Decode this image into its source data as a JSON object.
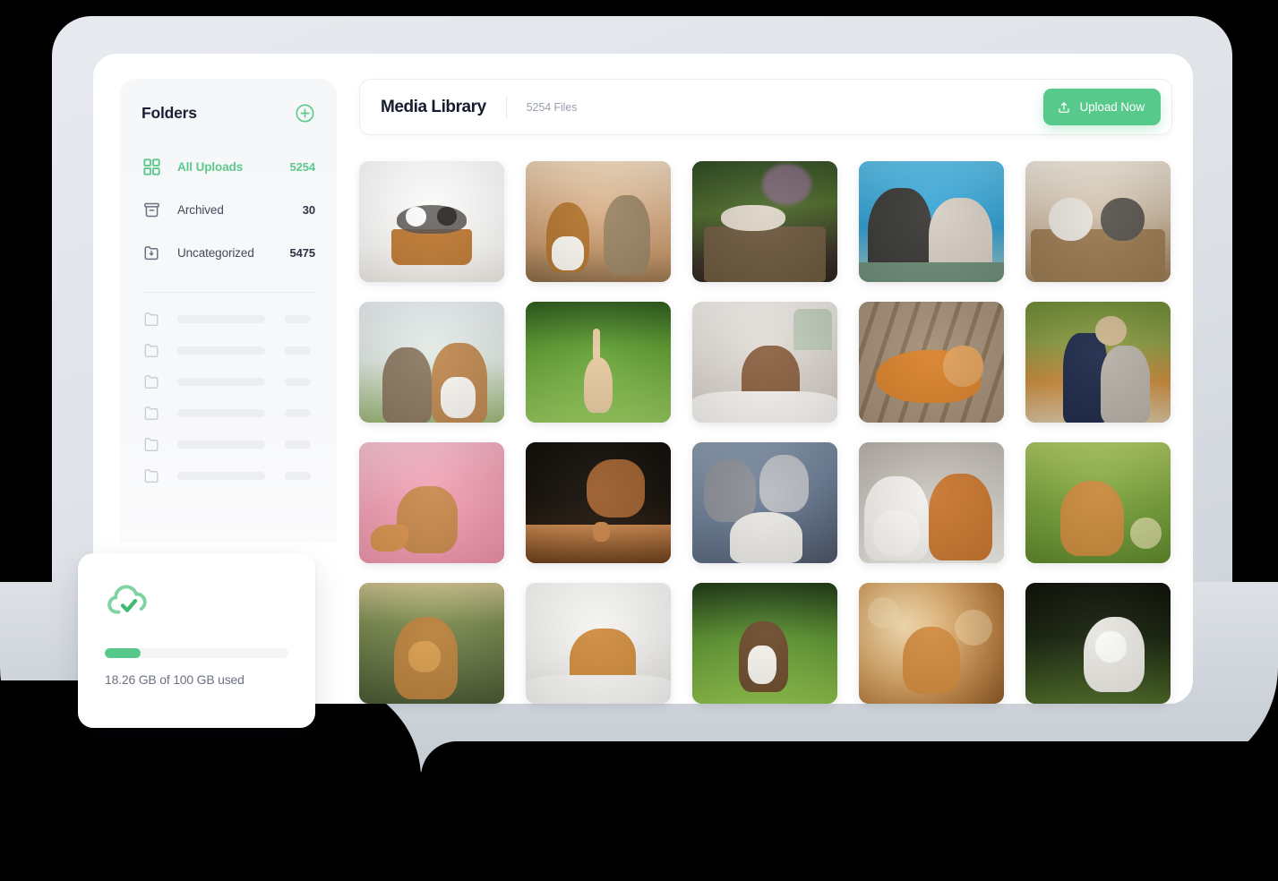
{
  "sidebar": {
    "title": "Folders",
    "add_icon": "circle-plus-icon",
    "items": [
      {
        "label": "All Uploads",
        "count": "5254",
        "icon": "grid-icon",
        "active": true
      },
      {
        "label": "Archived",
        "count": "30",
        "icon": "archive-box-icon",
        "active": false
      },
      {
        "label": "Uncategorized",
        "count": "5475",
        "icon": "folder-download-icon",
        "active": false
      }
    ],
    "skeleton_rows": 6,
    "skeleton_icon": "folder-outline-icon"
  },
  "header": {
    "title": "Media Library",
    "file_count": "5254 Files",
    "upload_label": "Upload Now",
    "upload_icon": "upload-tray-icon"
  },
  "storage": {
    "icon": "cloud-check-icon",
    "used_text": "18.26 GB of 100 GB used",
    "used_gb": 18.26,
    "total_gb": 100,
    "percent": 18.26
  },
  "colors": {
    "accent_green": "#57c98a",
    "title_dark": "#161c2e",
    "muted_grey": "#9aa1ae",
    "panel_grey": "#f6f7f9",
    "shell_grey": "#dfe3e8"
  },
  "gallery": {
    "columns": 5,
    "rows": 4,
    "tiles": [
      {
        "alt": "kittens and puppies in a wicker basket on white background",
        "c1": "#fdfdfd",
        "c2": "#f4f2ef",
        "c3": "#c07b35",
        "c4": "#55504c",
        "style": "basket-white"
      },
      {
        "alt": "corgi and yorkshire terrier running on a sunlit path",
        "c1": "#d9b089",
        "c2": "#c89a6e",
        "c3": "#8a6a46",
        "c4": "#f0dcc0",
        "style": "warm-run"
      },
      {
        "alt": "kittens in a wooden crate under lilac blossoms",
        "c1": "#2f4a22",
        "c2": "#4e6b2c",
        "c3": "#6d5a3f",
        "c4": "#8e6a8c",
        "style": "garden-crate"
      },
      {
        "alt": "dog and puppy looking up against a blue sky",
        "c1": "#2f9dd0",
        "c2": "#59bde6",
        "c3": "#3b3a38",
        "c4": "#d8cfc4",
        "style": "sky-blue"
      },
      {
        "alt": "two kittens resting in a woven basket",
        "c1": "#cdbca6",
        "c2": "#9b7b52",
        "c3": "#5a5550",
        "c4": "#efe7dc",
        "style": "basket-brown"
      },
      {
        "alt": "terrier and corgi sitting in tall grass",
        "c1": "#e8eef0",
        "c2": "#9fb97a",
        "c3": "#c08a52",
        "c4": "#f3f5f3",
        "style": "pale-grass"
      },
      {
        "alt": "ginger kitten running across a bright green lawn",
        "c1": "#5f9e32",
        "c2": "#97c95c",
        "c3": "#2d5c1d",
        "c4": "#e6c9a0",
        "style": "green-lawn"
      },
      {
        "alt": "cockapoo puppy lying on a white bed",
        "c1": "#f2eeea",
        "c2": "#dcd6cf",
        "c3": "#8c6142",
        "c4": "#b8c9b4",
        "style": "bed-white"
      },
      {
        "alt": "orange tabby cat lying on a wooden floor",
        "c1": "#a59078",
        "c2": "#8a7258",
        "c3": "#d9822b",
        "c4": "#efe3d2",
        "style": "wood-floor"
      },
      {
        "alt": "husky and cat hugging among autumn leaves",
        "c1": "#c98b3c",
        "c2": "#6d8a34",
        "c3": "#1e2a4a",
        "c4": "#d9c4a0",
        "style": "autumn"
      },
      {
        "alt": "fluffy ginger cat on a pink backdrop",
        "c1": "#f2a0b4",
        "c2": "#ef93aa",
        "c3": "#c98a4e",
        "c4": "#f7c3d1",
        "style": "pink-studio"
      },
      {
        "alt": "bordeaux mastiff puppy leaning on a wooden box, dark studio",
        "c1": "#120d08",
        "c2": "#3c2513",
        "c3": "#9b5d2c",
        "c4": "#c8854a",
        "style": "dark-studio"
      },
      {
        "alt": "three kittens cuddled on a denim lap",
        "c1": "#6b7c93",
        "c2": "#8a9aae",
        "c3": "#eceae6",
        "c4": "#4a5568",
        "style": "denim-kittens"
      },
      {
        "alt": "two smiling corgis on pavement",
        "c1": "#cfcbc4",
        "c2": "#b7b1a8",
        "c3": "#c9772f",
        "c4": "#f4f2ee",
        "style": "pavement"
      },
      {
        "alt": "tabby cat in sunlit grass with dandelions",
        "c1": "#7ba33c",
        "c2": "#a8c45e",
        "c3": "#c98a3c",
        "c4": "#e8e2b0",
        "style": "sun-grass"
      },
      {
        "alt": "golden cockapoo puppy in a grassy field at dusk",
        "c1": "#4a5a34",
        "c2": "#7a8a4e",
        "c3": "#b9813c",
        "c4": "#cbbf8c",
        "style": "dusk-field"
      },
      {
        "alt": "ginger kitten sitting on a white blanket",
        "c1": "#f4f3f1",
        "c2": "#e5e2dd",
        "c3": "#cf8b3e",
        "c4": "#fbfaf8",
        "style": "white-blanket"
      },
      {
        "alt": "border collie running on green grass",
        "c1": "#1f3a16",
        "c2": "#5c9330",
        "c3": "#8ec04a",
        "c4": "#6b4a2a",
        "style": "collie-grass"
      },
      {
        "alt": "orange cat with golden bokeh lights",
        "c1": "#b57a3d",
        "c2": "#d8a768",
        "c3": "#f2d9ad",
        "c4": "#8a5a2a",
        "style": "bokeh"
      },
      {
        "alt": "white maltipoo puppy running on a dark lawn",
        "c1": "#0e1208",
        "c2": "#2e4418",
        "c3": "#e8e6e0",
        "c4": "#4e6a28",
        "style": "night-lawn"
      }
    ]
  }
}
